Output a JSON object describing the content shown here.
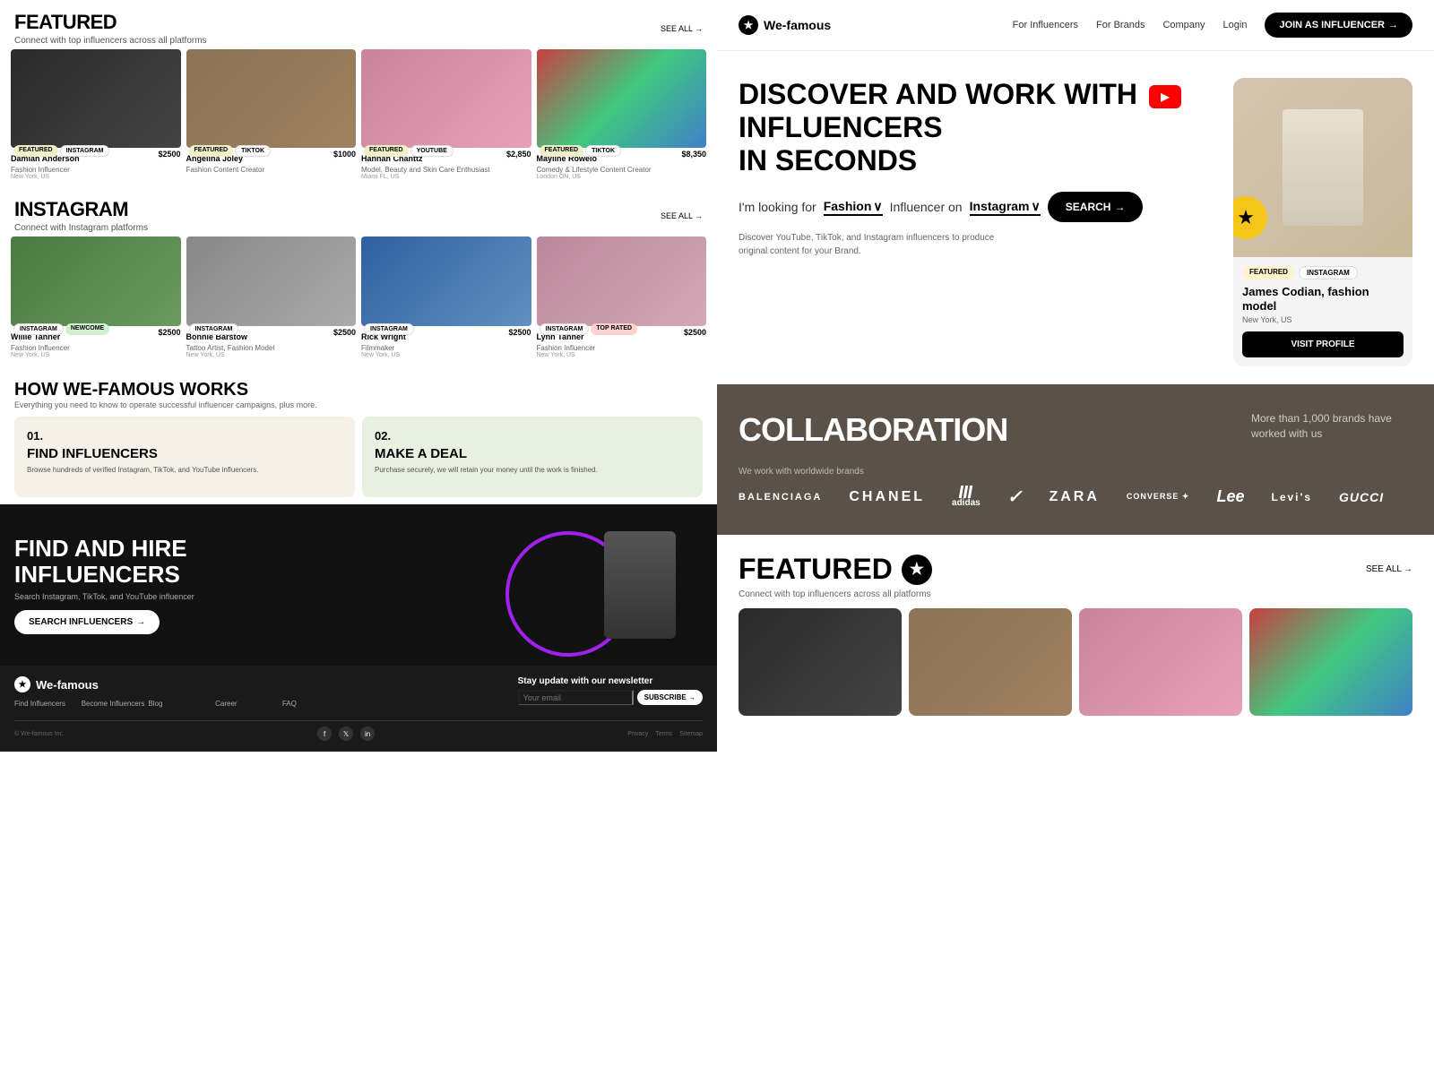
{
  "left": {
    "featured_title": "FEATURED",
    "featured_subtitle": "Connect with top influencers across all platforms",
    "see_all": "SEE ALL",
    "influencers": [
      {
        "name": "Damian Anderson",
        "price": "$2500",
        "role": "Fashion Influencer",
        "location": "New York, US",
        "badge1": "FEATURED",
        "badge2": "INSTAGRAM",
        "img": "img-dark"
      },
      {
        "name": "Angelina Joley",
        "price": "$1000",
        "role": "Fashion Content Creator",
        "location": "",
        "badge1": "FEATURED",
        "badge2": "TIKTOK",
        "img": "img-warm"
      },
      {
        "name": "Hannah Chanttz",
        "price": "$2,850",
        "role": "Model, Beauty and Skin Care Enthusiast",
        "location": "Miami FL, US",
        "badge1": "FEATURED",
        "badge2": "YOUTUBE",
        "img": "img-pink"
      },
      {
        "name": "Mayline Rowelo",
        "price": "$8,350",
        "role": "Comedy & Lifestyle Content Creator",
        "location": "London ON, US",
        "badge1": "FEATURED",
        "badge2": "TIKTOK",
        "img": "img-colorful"
      }
    ],
    "instagram_title": "INSTAGRAM",
    "instagram_subtitle": "Connect with Instagram platforms",
    "instagram_influencers": [
      {
        "name": "Willie Tanner",
        "price": "$2500",
        "role": "Fashion Influencer",
        "location": "New York, US",
        "badge1": "INSTAGRAM",
        "badge2": "NEWCOME",
        "img": "img-green"
      },
      {
        "name": "Bonnie Barstow",
        "price": "$2500",
        "role": "Tattoo Artist, Fashion Model",
        "location": "New York, US",
        "badge1": "INSTAGRAM",
        "badge2": "",
        "img": "img-grey"
      },
      {
        "name": "Rick Wright",
        "price": "$2500",
        "role": "Filmmaker",
        "location": "New York, US",
        "badge1": "INSTAGRAM",
        "badge2": "",
        "img": "img-blue"
      },
      {
        "name": "Lynn Tanner",
        "price": "$2500",
        "role": "Fashion Influencer",
        "location": "New York, US",
        "badge1": "INSTAGRAM",
        "badge2": "TOP RATED",
        "img": "img-makeup"
      }
    ],
    "how_title": "HOW WE-FAMOUS WORKS",
    "how_subtitle": "Everything you need to know to operate successful influencer campaigns, plus more.",
    "how_cards": [
      {
        "step": "01.",
        "title": "FIND INFLUENCERS",
        "desc": "Browse hundreds of verified Instagram, TikTok, and YouTube influencers."
      },
      {
        "step": "02.",
        "title": "MAKE A DEAL",
        "desc": "Purchase securely, we will retain your money until the work is finished."
      }
    ],
    "find_hire_title": "FIND AND HIRE INFLUENCERS",
    "find_hire_desc": "Search Instagram, TikTok, and YouTube influencer",
    "search_btn": "SEARCH INFLUENCERS",
    "footer_logo": "We-famous",
    "footer_links": [
      "Find Influencers",
      "Become Influencers",
      "Blog",
      "Career",
      "FAQ"
    ],
    "newsletter_title": "Stay update with our newsletter",
    "newsletter_placeholder": "Your email",
    "subscribe_btn": "SUBSCRIBE",
    "footer_copy": "© We-famous Inc.",
    "footer_legal": [
      "Privacy",
      "Terms",
      "Sitemap"
    ]
  },
  "right": {
    "nav": {
      "logo": "We-famous",
      "links": [
        "For Influencers",
        "For Brands",
        "Company",
        "Login"
      ],
      "join_btn": "JOIN AS INFLUENCER"
    },
    "hero": {
      "title_part1": "DISCOVER AND WORK WITH",
      "title_part2": "INFLUENCERS",
      "title_part3": "IN SECONDS",
      "search_label": "I'm looking for",
      "category": "Fashion",
      "platform": "Instagram",
      "search_btn": "SEARCH",
      "description": "Discover YouTube, TikTok, and Instagram influencers to produce original content for your Brand.",
      "card": {
        "badge1": "FEATURED",
        "badge2": "INSTAGRAM",
        "name": "James Codian, fashion model",
        "location": "New York, US",
        "visit_btn": "VISIT PROFILE"
      }
    },
    "collab": {
      "title": "COLLABORATION",
      "desc": "More than 1,000 brands have worked with us",
      "subtitle": "We work with worldwide brands",
      "brands": [
        "BALENCIAGA",
        "CHANEL",
        "adidas",
        "Nike",
        "ZARA",
        "Converse",
        "Lee",
        "Levi's",
        "GUCCI"
      ]
    },
    "featured": {
      "title": "FEATURED",
      "subtitle": "Connect with top influencers across all platforms",
      "see_all": "SEE ALL",
      "cards": [
        {
          "img": "img-dark"
        },
        {
          "img": "img-warm"
        },
        {
          "img": "img-pink"
        },
        {
          "img": "img-colorful"
        }
      ]
    }
  }
}
